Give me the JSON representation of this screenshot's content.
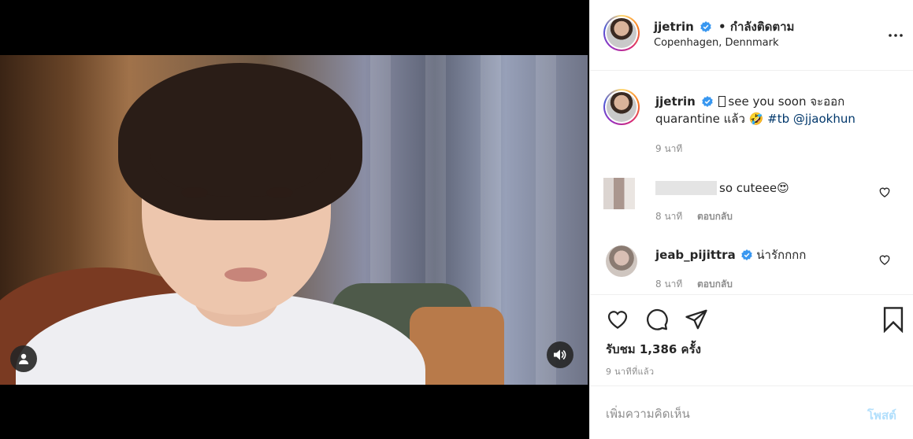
{
  "post": {
    "author": "jjetrin",
    "follow_status": "• กำลังติดตาม",
    "location": "Copenhagen, Dennmark",
    "caption_text_1": "see you soon จะออก",
    "caption_text_2": "quarantine แล้ว 🤣",
    "caption_hashtag": "#tb",
    "caption_mention": "@jjaokhun",
    "caption_time": "9 นาที",
    "views": "รับชม 1,386 ครั้ง",
    "posted_time": "9 นาทีที่แล้ว"
  },
  "comments": [
    {
      "username": "",
      "text": "so cuteee😍",
      "time": "8 นาที",
      "reply": "ตอบกลับ"
    },
    {
      "username": "jeab_pijittra",
      "text": "น่ารักกกก",
      "time": "8 นาที",
      "reply": "ตอบกลับ"
    }
  ],
  "composer": {
    "placeholder": "เพิ่มความคิดเห็น",
    "post_button": "โพสต์"
  },
  "icons": {
    "more": "more-options-icon",
    "like": "heart-icon",
    "comment": "comment-icon",
    "share": "share-icon",
    "save": "bookmark-icon",
    "user_tag": "user-tag-icon",
    "sound": "speaker-icon",
    "verified": "verified-badge-icon"
  },
  "colors": {
    "verified": "#3897f0",
    "link": "#00376b",
    "post_button_disabled": "#b2dffc",
    "muted": "#8e8e8e"
  }
}
